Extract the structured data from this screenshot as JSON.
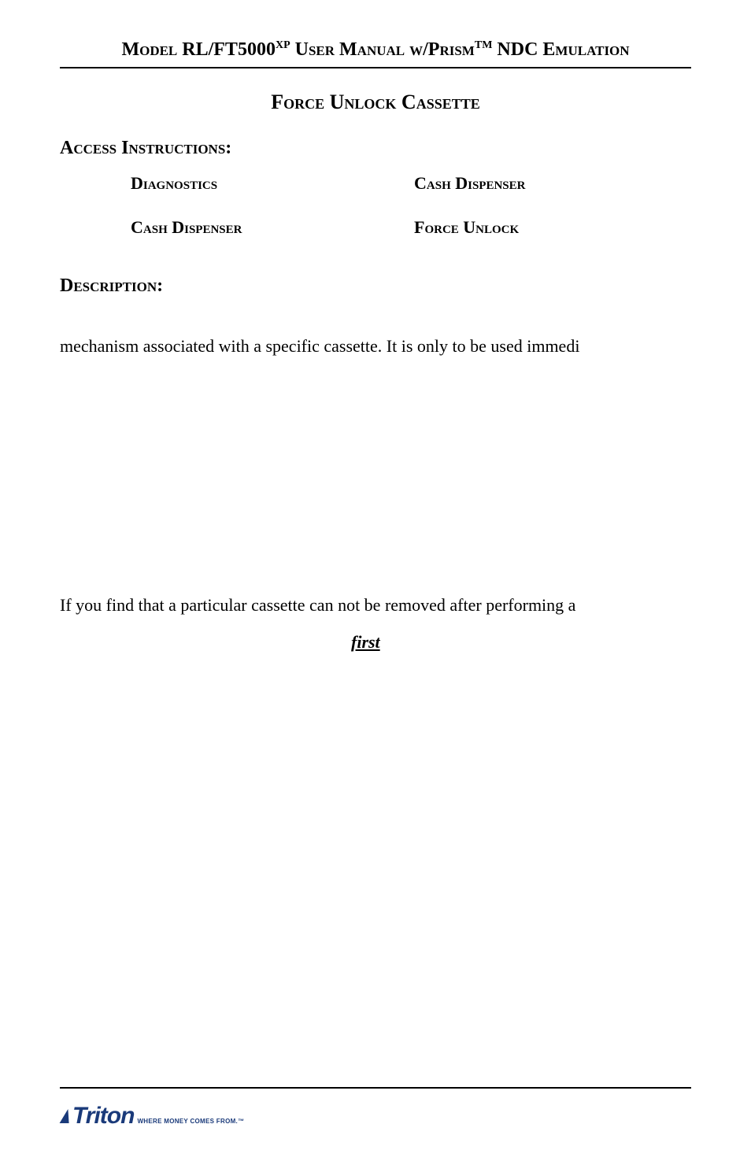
{
  "header": {
    "title_part1": "Model RL/FT5000",
    "title_sup1": "XP",
    "title_part2": " User Manual w/Prism",
    "title_sup2": "TM",
    "title_part3": " NDC Emulation"
  },
  "section": {
    "title": "Force Unlock Cassette"
  },
  "access": {
    "heading": "Access Instructions:",
    "row1_col1": "Diagnostics",
    "row1_col2": "Cash  Dispenser",
    "row2_col1": "Cash Dispenser",
    "row2_col2": "Force Unlock"
  },
  "description": {
    "heading": "Description:",
    "para1": "mechanism associated with a specific cassette.  It is only to be used immedi",
    "para2_line1": "If you find that a particular cassette can not be removed after performing a",
    "para2_emphasis": "first"
  },
  "footer": {
    "logo_text": "Triton",
    "logo_tagline": "WHERE MONEY COMES FROM.™"
  }
}
